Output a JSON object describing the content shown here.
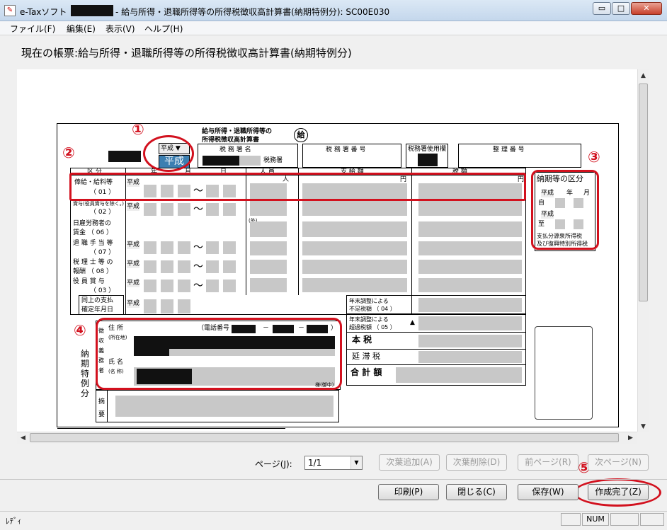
{
  "window": {
    "title_app": "e-Taxソフト",
    "title_document": "- 給与所得・退職所得等の所得税徴収高計算書(納期特例分): SC00E030",
    "minimize_symbol": "▭",
    "maximize_symbol": "□",
    "close_symbol": "✕"
  },
  "menu": {
    "file": "ファイル(F)",
    "edit": "編集(E)",
    "view": "表示(V)",
    "help": "ヘルプ(H)"
  },
  "current_form_label": "現在の帳票:給与所得・退職所得等の所得税徴収高計算書(納期特例分)",
  "form": {
    "title_line1": "給与所得・退職所得等の",
    "title_line2": "所得税徴収高計算書",
    "stamp_char": "給",
    "era_dropdown_label": "平成 ▼",
    "era_selected": "平成",
    "tax_office_name_label": "税 務 署 名",
    "tax_office_suffix": "税務署",
    "tax_office_number_label": "税 務 署 番 号",
    "tax_office_use_label": "税務署使用欄",
    "reference_number_label": "整 理 番 号",
    "col_category": "区 分",
    "col_year": "年",
    "col_month": "月",
    "col_day": "日",
    "col_people": "人 員",
    "col_payment": "支 給 額",
    "col_tax": "税 額",
    "unit_person": "人",
    "unit_yen": "円",
    "era": "平成",
    "tilde": "〜",
    "row_salary": "俸給・給料等",
    "row_salary_code": "（ 01 ）",
    "row_bonus": "賞与(役員賞与を除く。)",
    "row_bonus_code": "（ 02 ）",
    "row_day_labor_1": "日雇労務者の",
    "row_day_labor_2": "賃金 （ 06 ）",
    "row_retirement_1": "退 職 手 当 等",
    "row_retirement_2": "（ 07 ）",
    "row_tax_accountant_1": "税 理 士 等 の",
    "row_tax_accountant_2": "報酬 （ 08 ）",
    "row_officer_bonus_1": "役 員 賞 与",
    "row_officer_bonus_2": "（ 03 ）",
    "row_payment_date_1": "同上の支払",
    "row_payment_date_2": "確定年月日",
    "dependent_mark": "(外)",
    "yearend_shortfall_1": "年末調整による",
    "yearend_shortfall_2": "不足税額 （ 04 ）",
    "yearend_excess_1": "年末調整による",
    "yearend_excess_2": "超過税額 （ 05 ）",
    "triangle_mark": "▲",
    "principal_tax": "本 税",
    "late_tax": "延 滞 税",
    "total": "合 計 額",
    "period_box_title": "納期等の区分",
    "period_year": "年",
    "period_month": "月",
    "period_from": "自",
    "period_to": "至",
    "period_note_1": "支払分源泉所得税",
    "period_note_2": "及び復興特別所得税",
    "address_label": "住 所",
    "address_sub": "(所在地)",
    "phone_label": "（電話番号",
    "phone_dash": "－",
    "phone_close": "）",
    "name_label": "氏 名",
    "name_sub": "(名 称)",
    "name_suffix": "様(御中)",
    "withholder_vertical": "徴収義務者",
    "special_vertical": "納期特例分",
    "remarks_vertical": "摘要"
  },
  "annotations": [
    "①",
    "②",
    "③",
    "④",
    "⑤"
  ],
  "page_nav": {
    "page_label": "ページ(J):",
    "page_value": "1/1",
    "add_next_page": "次葉追加(A)",
    "delete_next_page": "次葉削除(D)",
    "prev_page": "前ページ(R)",
    "next_page": "次ページ(N)"
  },
  "actions": {
    "print": "印刷(P)",
    "close": "閉じる(C)",
    "save": "保存(W)",
    "finish": "作成完了(Z)"
  },
  "status": {
    "text": "ﾚﾃﾞｨ",
    "num": "NUM"
  }
}
